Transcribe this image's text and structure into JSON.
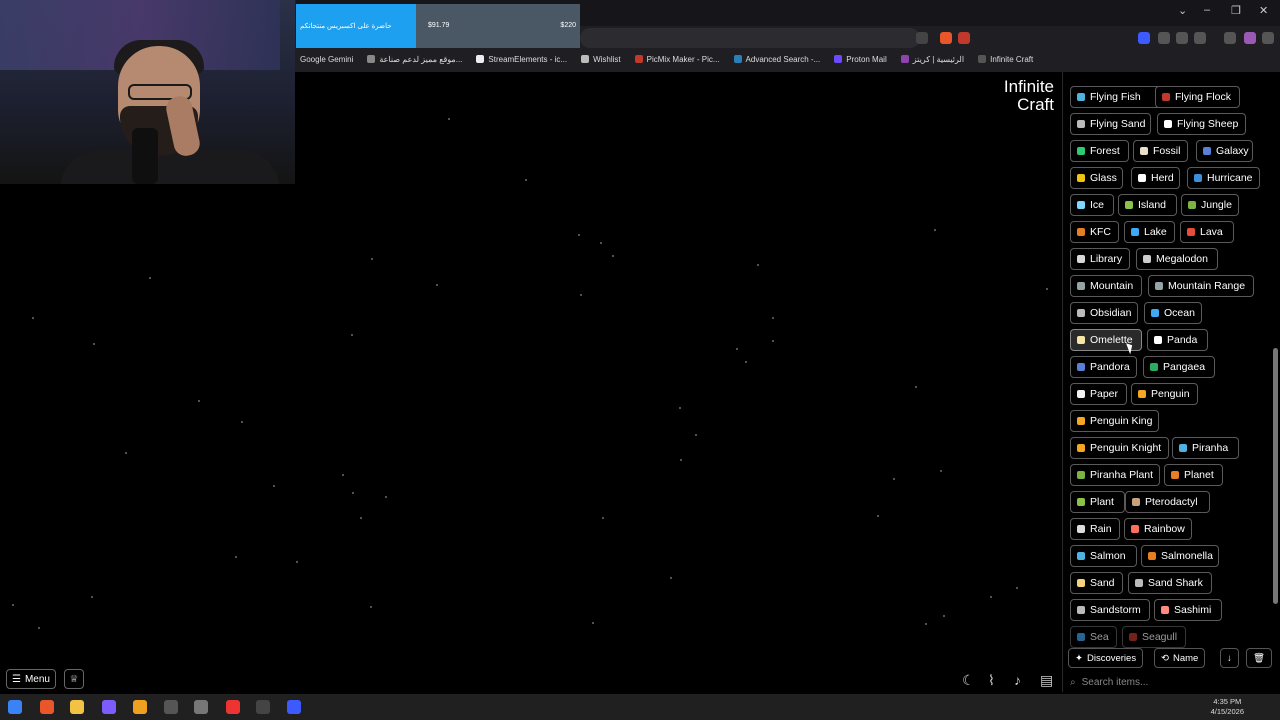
{
  "browser": {
    "donation": {
      "text": "حاضرة على اكسبريس منتجاتكم",
      "raised": "$91.79",
      "goal": "$220"
    },
    "bookmarks": [
      "Google Gemini",
      "موقع مميز لدعم صناعة...",
      "StreamElements - ic...",
      "Wishlist",
      "PicMix Maker - Pic...",
      "Advanced Search -...",
      "Proton Mail",
      "الرئيسية | كريتز",
      "Infinite Craft"
    ]
  },
  "game": {
    "logo_line1": "Infinite",
    "logo_line2": "Craft",
    "menu_label": "Menu"
  },
  "sidebar": {
    "items": [
      {
        "label": "Flying Fish",
        "color": "#4fb3e0"
      },
      {
        "label": "Flying Flock",
        "color": "#c0392b"
      },
      {
        "label": "Flying Sand",
        "color": "#bbbbbb"
      },
      {
        "label": "Flying Sheep",
        "color": "#ffffff"
      },
      {
        "label": "Forest",
        "color": "#2ecc71"
      },
      {
        "label": "Fossil",
        "color": "#e8e0c8"
      },
      {
        "label": "Galaxy",
        "color": "#5b7fd6"
      },
      {
        "label": "Glass",
        "color": "#f1c40f"
      },
      {
        "label": "Herd",
        "color": "#ffffff"
      },
      {
        "label": "Hurricane",
        "color": "#3d8fd9"
      },
      {
        "label": "Ice",
        "color": "#7fd6ff"
      },
      {
        "label": "Island",
        "color": "#8bc34a"
      },
      {
        "label": "Jungle",
        "color": "#7cb342"
      },
      {
        "label": "KFC",
        "color": "#e67e22"
      },
      {
        "label": "Lake",
        "color": "#3fa9f5"
      },
      {
        "label": "Lava",
        "color": "#e74c3c"
      },
      {
        "label": "Library",
        "color": "#d8d8d8"
      },
      {
        "label": "Megalodon",
        "color": "#cccccc"
      },
      {
        "label": "Mountain",
        "color": "#95a5a6"
      },
      {
        "label": "Mountain Range",
        "color": "#95a5a6"
      },
      {
        "label": "Obsidian",
        "color": "#bbbbbb"
      },
      {
        "label": "Ocean",
        "color": "#3fa9f5"
      },
      {
        "label": "Omelette",
        "color": "#f5e6a8"
      },
      {
        "label": "Panda",
        "color": "#ffffff"
      },
      {
        "label": "Pandora",
        "color": "#5b7fd6"
      },
      {
        "label": "Pangaea",
        "color": "#27ae60"
      },
      {
        "label": "Paper",
        "color": "#f2f2f2"
      },
      {
        "label": "Penguin",
        "color": "#f5a623"
      },
      {
        "label": "Penguin King",
        "color": "#f5a623"
      },
      {
        "label": "Penguin Knight",
        "color": "#f5a623"
      },
      {
        "label": "Piranha",
        "color": "#4fb3e0"
      },
      {
        "label": "Piranha Plant",
        "color": "#7cb342"
      },
      {
        "label": "Planet",
        "color": "#e67e22"
      },
      {
        "label": "Plant",
        "color": "#8bc34a"
      },
      {
        "label": "Pterodactyl",
        "color": "#c8a27a"
      },
      {
        "label": "Rain",
        "color": "#dddddd"
      },
      {
        "label": "Rainbow",
        "color": "#ff6f61"
      },
      {
        "label": "Salmon",
        "color": "#4fb3e0"
      },
      {
        "label": "Salmonella",
        "color": "#e67e22"
      },
      {
        "label": "Sand",
        "color": "#f4d27a"
      },
      {
        "label": "Sand Shark",
        "color": "#bbbbbb"
      },
      {
        "label": "Sandstorm",
        "color": "#bbbbbb"
      },
      {
        "label": "Sashimi",
        "color": "#ff8a80"
      },
      {
        "label": "Sea",
        "color": "#3fa9f5"
      },
      {
        "label": "Seagull",
        "color": "#c0392b"
      }
    ],
    "tabs": {
      "discoveries": "Discoveries",
      "sort": "Name"
    },
    "search_placeholder": "Search items..."
  },
  "taskbar": {
    "time": "4:35 PM",
    "date": "4/15/2026"
  }
}
